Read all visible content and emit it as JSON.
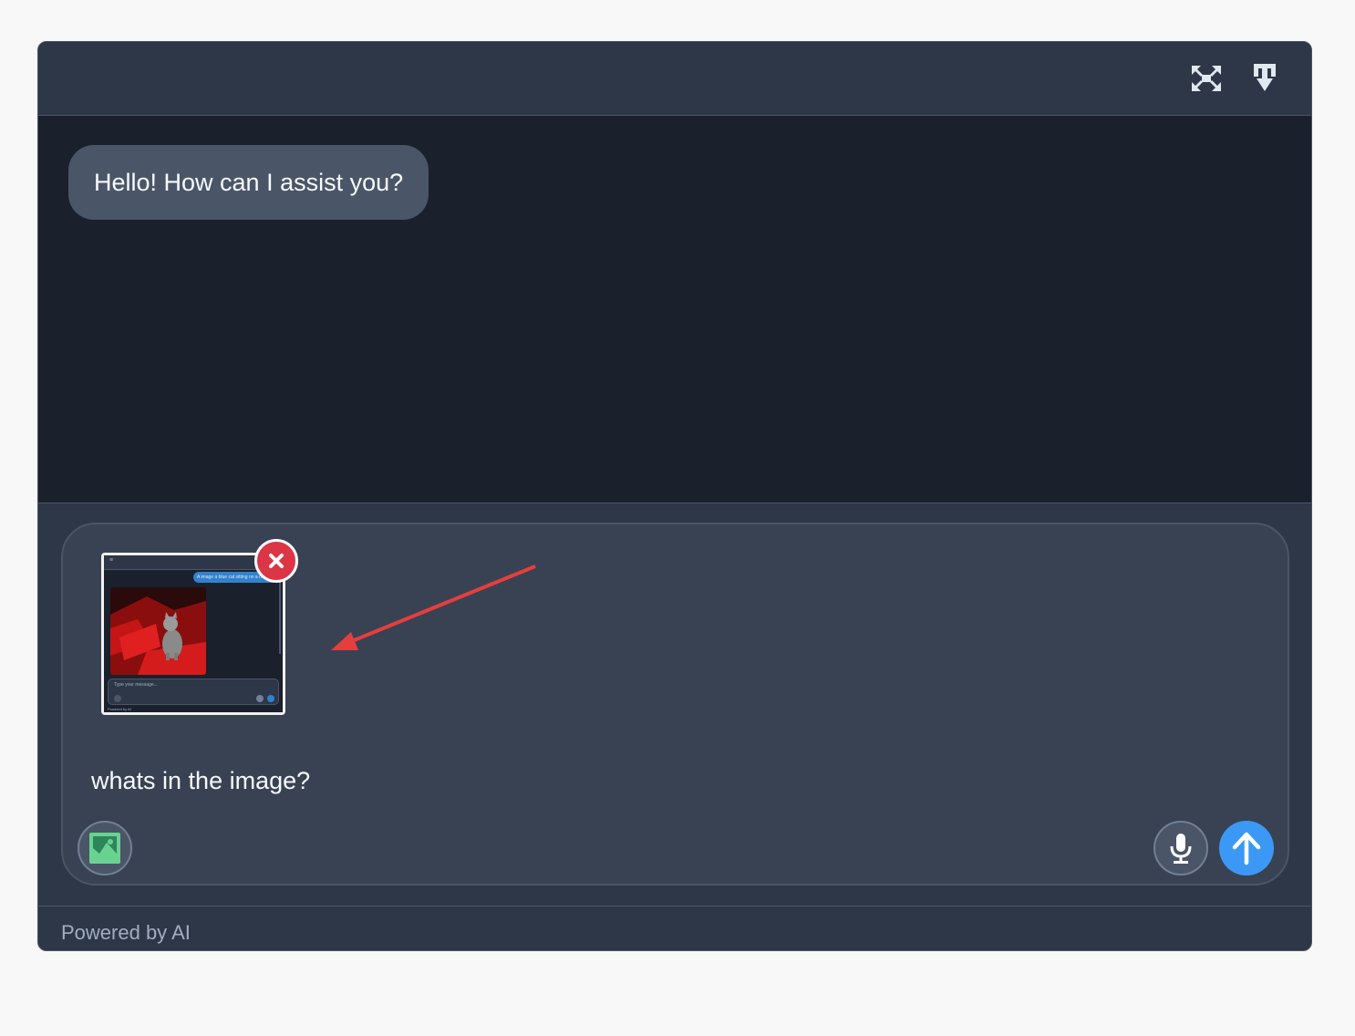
{
  "header": {
    "expand_icon": "expand-arrows-icon",
    "download_icon": "download-arrow-icon"
  },
  "messages": [
    {
      "role": "assistant",
      "text": "Hello! How can I assist you?"
    }
  ],
  "composer": {
    "attachment": {
      "description_icon": "screenshot-thumbnail",
      "mini_user_text": "A image a blue cat sitting on a red",
      "mini_placeholder": "Type your message...",
      "mini_footer": "Powered by AI"
    },
    "remove_icon": "close-x-icon",
    "text": "whats in the image?",
    "image_button_icon": "image-icon",
    "mic_icon": "microphone-icon",
    "send_icon": "arrow-up-icon"
  },
  "footer": {
    "text": "Powered by AI"
  },
  "colors": {
    "page_bg": "#f8f8f8",
    "window_bg": "#2d3748",
    "messages_bg": "#1a202c",
    "bubble_bg": "#4a5568",
    "composer_bg": "#394253",
    "send_button": "#3b99f5",
    "remove_button": "#dc3545",
    "image_icon": "#68d391",
    "annotation_arrow": "#e53e3e"
  }
}
